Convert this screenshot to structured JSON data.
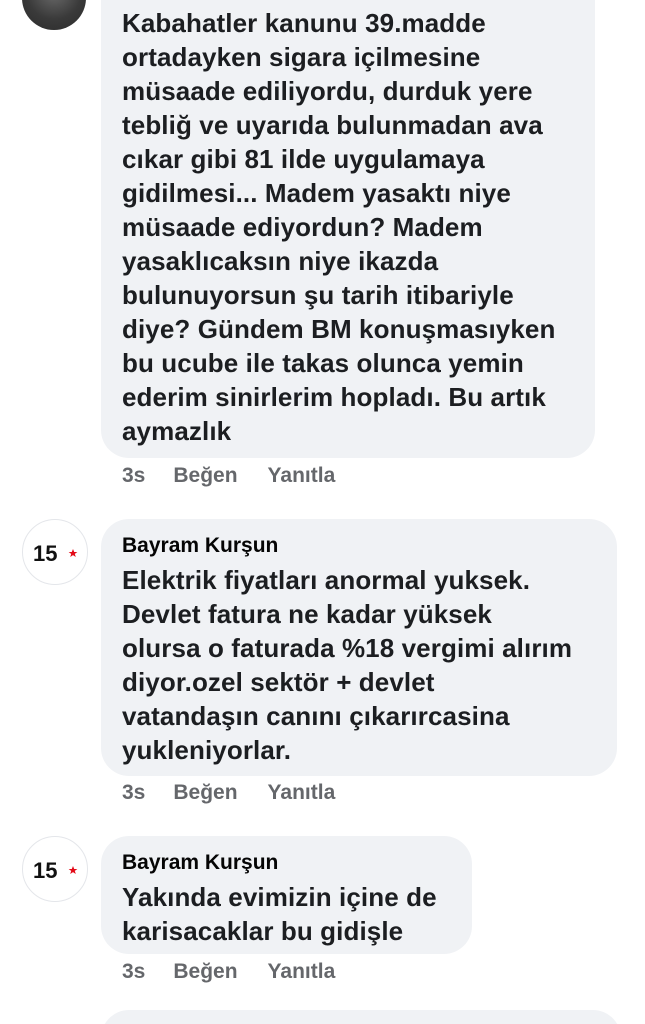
{
  "comments": [
    {
      "author": "",
      "text": "Kabahatler kanunu 39.madde\nortadayken sigara içilmesine\nmüsaade ediliyordu, durduk yere\ntebliğ ve uyarıda bulunmadan  ava\ncıkar gibi 81 ilde uygulamaya\ngidilmesi... Madem yasaktı niye\nmüsaade ediyordun? Madem\nyasaklıcaksın niye ikazda\nbulunuyorsun şu tarih itibariyle\ndiye? Gündem BM konuşmasıyken\nbu ucube ile takas olunca yemin\nederim sinirlerim hopladı. Bu artık\naymazlık",
      "time": "3s",
      "like_label": "Beğen",
      "reply_label": "Yanıtla"
    },
    {
      "author": "Bayram Kurşun",
      "text": "Elektrik fiyatları anormal yuksek.\nDevlet fatura ne kadar yüksek\nolursa o faturada %18 vergimi alırım\ndiyor.ozel sektör + devlet\nvatandaşın canını çıkarırcasina\nyukleniyorlar.",
      "time": "3s",
      "like_label": "Beğen",
      "reply_label": "Yanıtla"
    },
    {
      "author": "Bayram Kurşun",
      "text": "Yakında evimizin içine de\nkarisacaklar bu gidişle",
      "time": "3s",
      "like_label": "Beğen",
      "reply_label": "Yanıtla"
    }
  ],
  "avatar_logo": {
    "label": "15",
    "icon": "crescent-star-logo",
    "color": "#e30a17"
  }
}
